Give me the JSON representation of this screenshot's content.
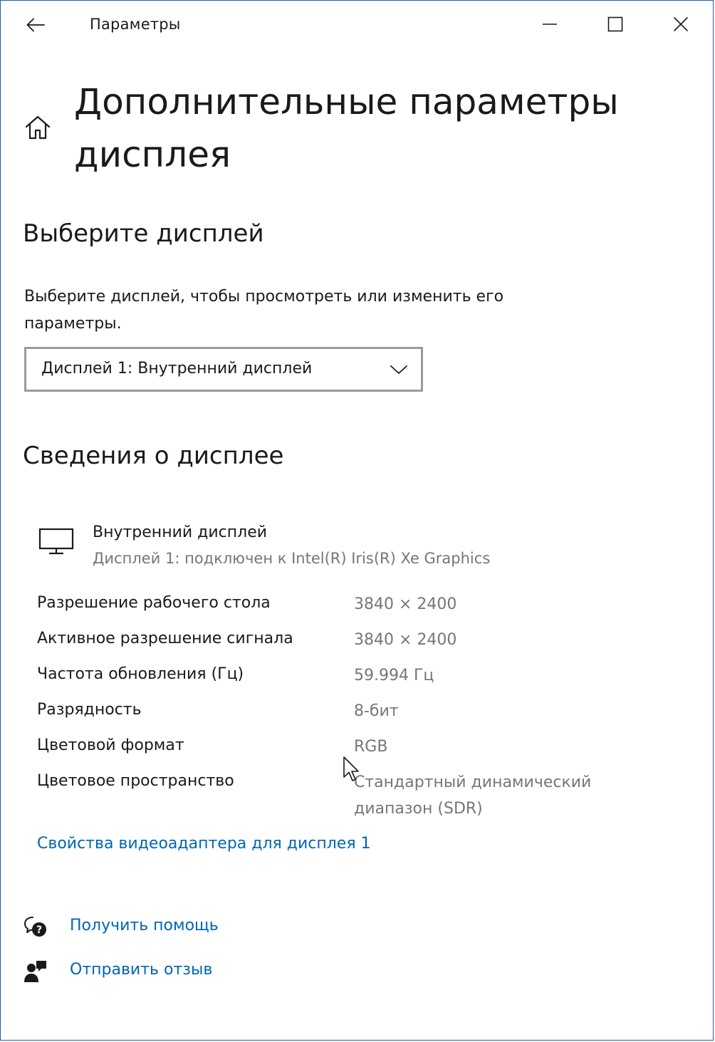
{
  "window": {
    "title": "Параметры"
  },
  "page": {
    "title": "Дополнительные параметры дисплея"
  },
  "select_display": {
    "heading": "Выберите дисплей",
    "description": "Выберите дисплей, чтобы просмотреть или изменить его параметры.",
    "dropdown_value": "Дисплей 1: Внутренний дисплей"
  },
  "display_info": {
    "heading": "Сведения о дисплее",
    "display_name": "Внутренний дисплей",
    "display_sub": "Дисплей 1: подключен к Intel(R) Iris(R) Xe Graphics",
    "properties": [
      {
        "label": "Разрешение рабочего стола",
        "value": "3840 × 2400"
      },
      {
        "label": "Активное разрешение сигнала",
        "value": "3840 × 2400"
      },
      {
        "label": "Частота обновления (Гц)",
        "value": "59.994 Гц"
      },
      {
        "label": "Разрядность",
        "value": "8-бит"
      },
      {
        "label": "Цветовой формат",
        "value": "RGB"
      },
      {
        "label": "Цветовое пространство",
        "value": "Стандартный динамический диапазон (SDR)"
      }
    ],
    "adapter_link": "Свойства видеоадаптера для дисплея 1"
  },
  "help": {
    "get_help": "Получить помощь",
    "send_feedback": "Отправить отзыв"
  },
  "icons": {
    "back": "back-arrow-icon",
    "minimize": "minimize-icon",
    "maximize": "maximize-icon",
    "close": "close-icon",
    "home": "home-icon",
    "chevron": "chevron-down-icon",
    "monitor": "monitor-icon",
    "help": "help-chat-icon",
    "feedback": "feedback-icon",
    "cursor": "mouse-cursor-icon"
  },
  "colors": {
    "link": "#0066b4",
    "secondary_text": "#767676",
    "window_border": "#1f5fa8",
    "dropdown_border": "#9a9a9a"
  }
}
